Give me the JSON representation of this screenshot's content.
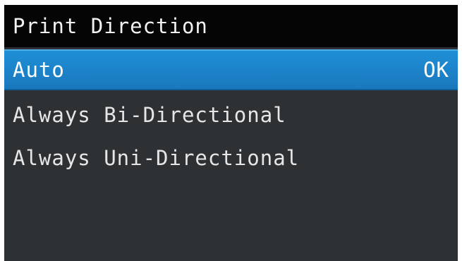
{
  "screen": {
    "title": "Print Direction",
    "colors": {
      "background": "#2e3133",
      "title_bar": "#050505",
      "selection": "#1a82c9",
      "text": "#ececec"
    },
    "menu": {
      "items": [
        {
          "label": "Auto",
          "selected": true,
          "action_hint": "OK"
        },
        {
          "label": "Always Bi-Directional",
          "selected": false
        },
        {
          "label": "Always Uni-Directional",
          "selected": false
        }
      ]
    }
  }
}
